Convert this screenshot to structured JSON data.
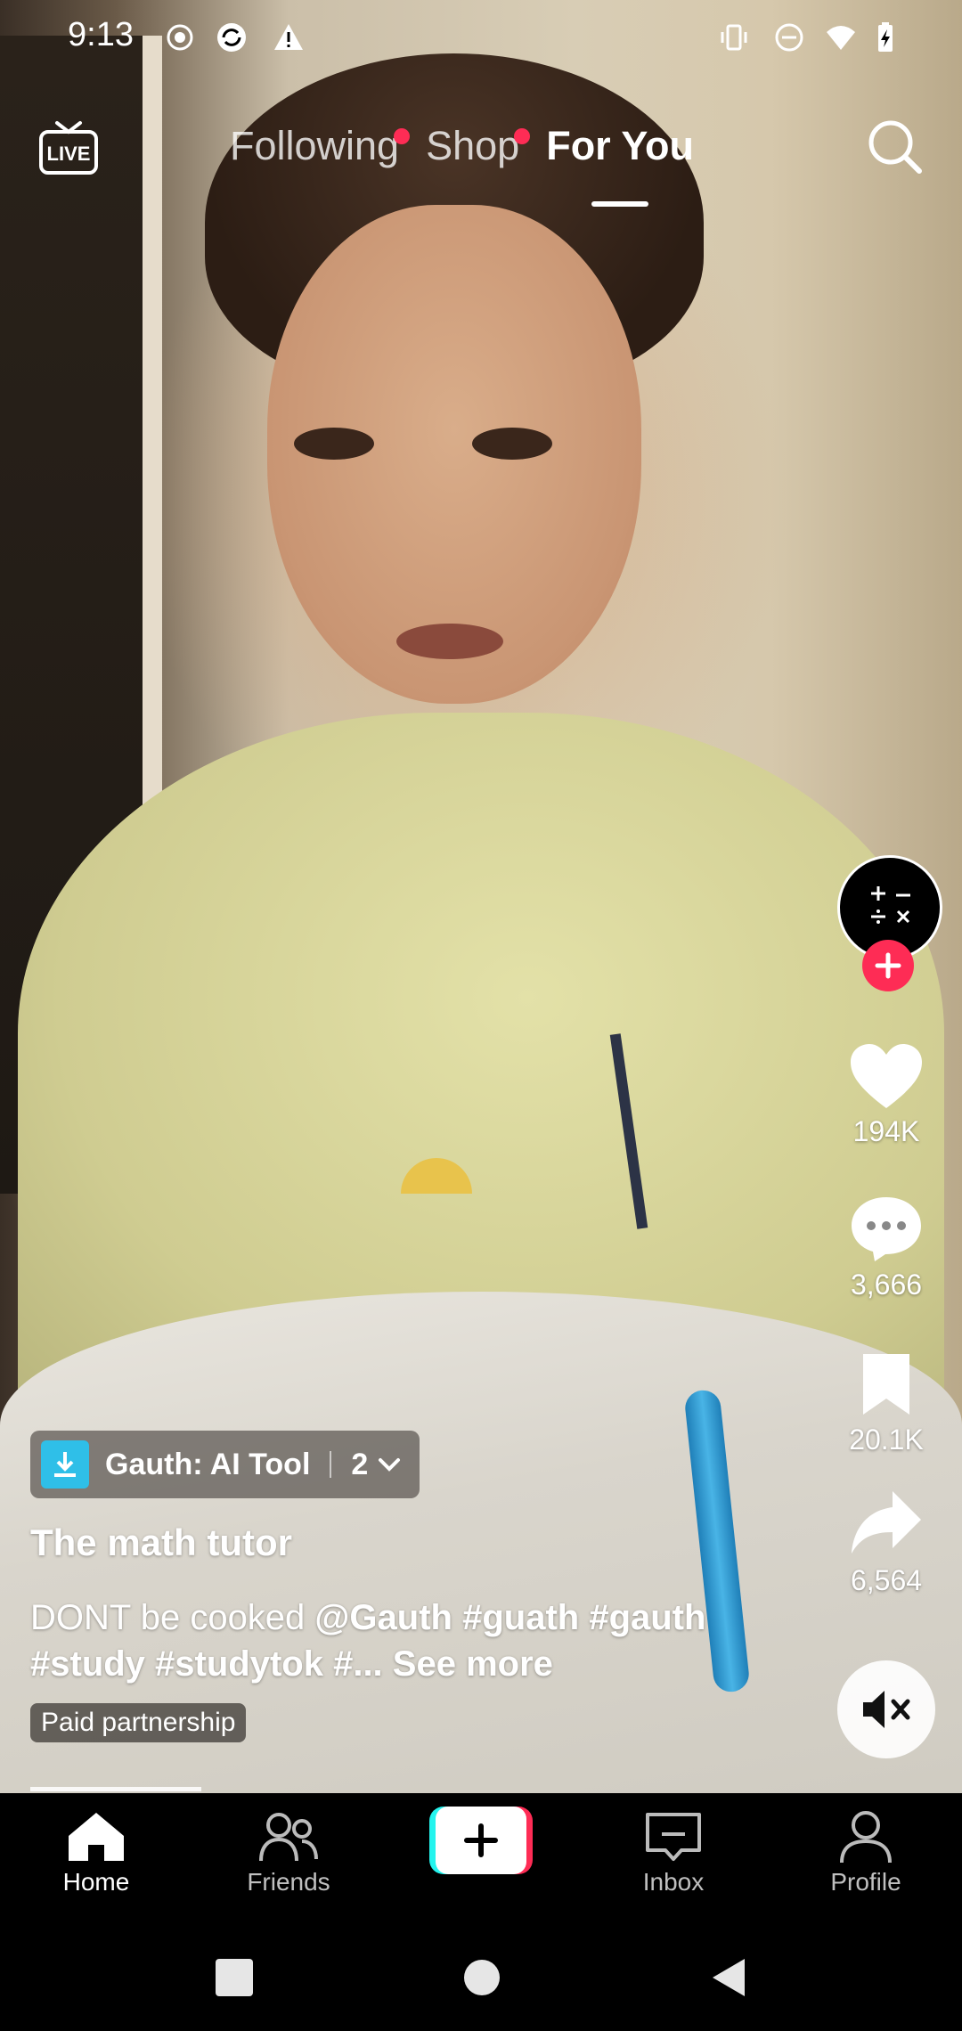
{
  "status_bar": {
    "time": "9:13",
    "icons": [
      "record-icon",
      "sync-icon",
      "warning-icon",
      "vibrate-icon",
      "do-not-disturb-icon",
      "wifi-icon",
      "battery-charging-icon"
    ]
  },
  "top_nav": {
    "live_label": "LIVE",
    "tabs": [
      {
        "label": "Following",
        "badge": true
      },
      {
        "label": "Shop",
        "badge": true
      },
      {
        "label": "For You",
        "active": true
      }
    ]
  },
  "rail": {
    "likes": "194K",
    "comments": "3,666",
    "saves": "20.1K",
    "shares": "6,564"
  },
  "post": {
    "app_chip": {
      "name": "Gauth: AI Tool",
      "count": "2"
    },
    "creator": "The math tutor",
    "caption_text": "DONT be cooked ",
    "caption_mention": "@Gauth",
    "caption_tags": " #guath #gauth #study #studytok #...",
    "see_more": "See more",
    "paid_label": "Paid partnership",
    "progress_fraction": 0.19
  },
  "bottom_nav": [
    {
      "label": "Home",
      "active": true
    },
    {
      "label": "Friends"
    },
    {
      "label": ""
    },
    {
      "label": "Inbox"
    },
    {
      "label": "Profile"
    }
  ],
  "colors": {
    "accent": "#fe2c55",
    "cyan": "#25f4ee",
    "download": "#2fbfe8"
  }
}
